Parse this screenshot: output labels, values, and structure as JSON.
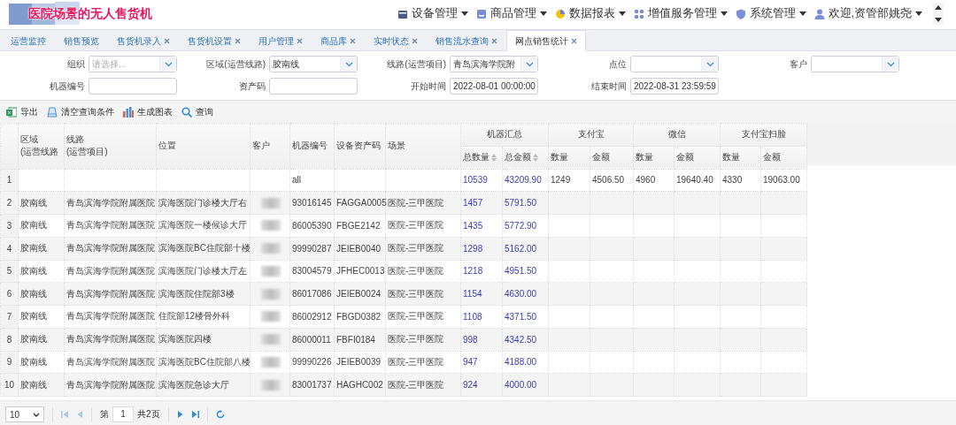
{
  "header": {
    "title": "医院场景的无人售货机",
    "menu": [
      {
        "label": "设备管理"
      },
      {
        "label": "商品管理"
      },
      {
        "label": "数据报表"
      },
      {
        "label": "增值服务管理"
      },
      {
        "label": "系统管理"
      },
      {
        "label": "欢迎,资管部姚尧"
      }
    ]
  },
  "tabs": [
    {
      "label": "运营监控",
      "closable": false,
      "selected": false
    },
    {
      "label": "销售预览",
      "closable": false,
      "selected": false
    },
    {
      "label": "售货机录入",
      "closable": true,
      "selected": false
    },
    {
      "label": "售货机设置",
      "closable": true,
      "selected": false
    },
    {
      "label": "用户管理",
      "closable": true,
      "selected": false
    },
    {
      "label": "商品库",
      "closable": true,
      "selected": false
    },
    {
      "label": "实时状态",
      "closable": true,
      "selected": false
    },
    {
      "label": "销售流水查询",
      "closable": true,
      "selected": false
    },
    {
      "label": "网点销售统计",
      "closable": true,
      "selected": true
    }
  ],
  "filters": [
    [
      {
        "label": "组织",
        "kind": "select",
        "placeholder": "请选择..."
      },
      {
        "label": "区域(运营线路)",
        "kind": "select",
        "value": "胶南线"
      },
      {
        "label": "线路(运营项目)",
        "kind": "select",
        "value": "青岛滨海学院附"
      },
      {
        "label": "点位",
        "kind": "select"
      },
      {
        "label": "客户",
        "kind": "select"
      }
    ],
    [
      {
        "label": "机器编号",
        "kind": "text"
      },
      {
        "label": "资产码",
        "kind": "text"
      },
      {
        "label": "开始时间",
        "kind": "text",
        "value": "2022-08-01 00:00:00"
      },
      {
        "label": "结束时间",
        "kind": "text",
        "value": "2022-08-31 23:59:59"
      }
    ]
  ],
  "toolbar": [
    {
      "label": "导出"
    },
    {
      "label": "清空查询条件"
    },
    {
      "label": "生成图表"
    },
    {
      "label": "查询"
    }
  ],
  "table": {
    "columns": [
      {
        "label": "区域\n(运营线路"
      },
      {
        "label": "线路\n(运营项目)"
      },
      {
        "label": "位置"
      },
      {
        "label": "客户"
      },
      {
        "label": "机器编号"
      },
      {
        "label": "设备资产码"
      },
      {
        "label": "场景"
      }
    ],
    "groups": [
      {
        "label": "机器汇总",
        "columns": [
          {
            "label": "总数量",
            "sortable": true,
            "link": true
          },
          {
            "label": "总金额",
            "sortable": true,
            "link": true
          }
        ]
      },
      {
        "label": "支付宝",
        "columns": [
          {
            "label": "数量",
            "sortable": false,
            "link": false
          },
          {
            "label": "金额",
            "sortable": false,
            "link": false
          }
        ]
      },
      {
        "label": "微信",
        "columns": [
          {
            "label": "数量",
            "sortable": false,
            "link": false
          },
          {
            "label": "金额",
            "sortable": false,
            "link": false
          }
        ]
      },
      {
        "label": "支付宝扫脸",
        "columns": [
          {
            "label": "数量",
            "sortable": false,
            "link": false
          },
          {
            "label": "金额",
            "sortable": false,
            "link": false
          }
        ]
      }
    ],
    "rows": [
      {
        "number": "1",
        "customer_blurred": false,
        "machine_no": "all",
        "total_qty": "10539",
        "total_amount": "43209.90",
        "alipay_qty": "1249",
        "alipay_amount": "4506.50",
        "wechat_qty": "4960",
        "wechat_amount": "19640.40",
        "face_qty": "4330",
        "face_amount": "19063.00"
      },
      {
        "number": "2",
        "region": "胶南线",
        "route": "青岛滨海学院附属医院",
        "location": "滨海医院门诊楼大厅右",
        "customer_blurred": true,
        "machine_no": "93016145",
        "asset_code": "FAGGA0005",
        "scene": "医院-三甲医院",
        "total_qty": "1457",
        "total_amount": "5791.50"
      },
      {
        "number": "3",
        "region": "胶南线",
        "route": "青岛滨海学院附属医院",
        "location": "滨海医院一楼候诊大厅",
        "customer_blurred": true,
        "machine_no": "86005390",
        "asset_code": "FBGE2142",
        "scene": "医院-三甲医院",
        "total_qty": "1435",
        "total_amount": "5772.90"
      },
      {
        "number": "4",
        "region": "胶南线",
        "route": "青岛滨海学院附属医院",
        "location": "滨海医院BC住院部十楼",
        "customer_blurred": true,
        "machine_no": "99990287",
        "asset_code": "JEIEB0040",
        "scene": "医院-三甲医院",
        "total_qty": "1298",
        "total_amount": "5162.00"
      },
      {
        "number": "5",
        "region": "胶南线",
        "route": "青岛滨海学院附属医院",
        "location": "滨海医院门诊楼大厅左",
        "customer_blurred": true,
        "machine_no": "83004579",
        "asset_code": "JFHEC0013",
        "scene": "医院-三甲医院",
        "total_qty": "1218",
        "total_amount": "4951.50"
      },
      {
        "number": "6",
        "region": "胶南线",
        "route": "青岛滨海学院附属医院",
        "location": "滨海医院住院部3楼",
        "customer_blurred": true,
        "machine_no": "86017086",
        "asset_code": "JEIEB0024",
        "scene": "医院-三甲医院",
        "total_qty": "1154",
        "total_amount": "4630.00"
      },
      {
        "number": "7",
        "region": "胶南线",
        "route": "青岛滨海学院附属医院",
        "location": "住院部12楼骨外科",
        "customer_blurred": true,
        "machine_no": "86002912",
        "asset_code": "FBGD0382",
        "scene": "医院-三甲医院",
        "total_qty": "1108",
        "total_amount": "4371.50"
      },
      {
        "number": "8",
        "region": "胶南线",
        "route": "青岛滨海学院附属医院",
        "location": "滨海医院四楼",
        "customer_blurred": true,
        "machine_no": "86000011",
        "asset_code": "FBFI0184",
        "scene": "医院-三甲医院",
        "total_qty": "998",
        "total_amount": "4342.50"
      },
      {
        "number": "9",
        "region": "胶南线",
        "route": "青岛滨海学院附属医院",
        "location": "滨海医院BC住院部八楼",
        "customer_blurred": true,
        "machine_no": "99990226",
        "asset_code": "JEIEB0039",
        "scene": "医院-三甲医院",
        "total_qty": "947",
        "total_amount": "4188.00"
      },
      {
        "number": "10",
        "region": "胶南线",
        "route": "青岛滨海学院附属医院",
        "location": "滨海医院急诊大厅",
        "customer_blurred": true,
        "machine_no": "83001737",
        "asset_code": "HAGHC002",
        "scene": "医院-三甲医院",
        "total_qty": "924",
        "total_amount": "4000.00"
      }
    ]
  },
  "pager": {
    "page_size": "10",
    "page_prefix": "第",
    "page": "1",
    "total_pages": "共2页"
  }
}
